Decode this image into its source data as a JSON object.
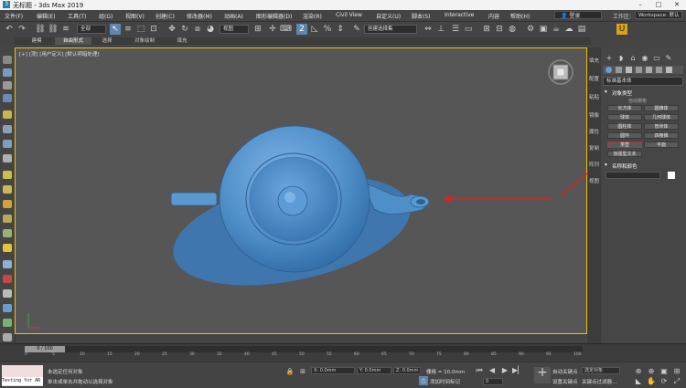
{
  "window": {
    "title": "无标题 - 3ds Max 2019",
    "app_icon": "3"
  },
  "menu": [
    "文件(F)",
    "编辑(E)",
    "工具(T)",
    "组(G)",
    "视图(V)",
    "创建(C)",
    "修改器(M)",
    "动画(A)",
    "图形编辑器(D)",
    "渲染(R)",
    "Civil View",
    "自定义(U)",
    "脚本(S)",
    "Interactive",
    "内容",
    "帮助(H)"
  ],
  "account": {
    "login": "登录",
    "workspace_label": "工作区:",
    "workspace": "Workspace: 默认"
  },
  "toolbar": {
    "selection_set": "全部",
    "view_combo": "视图",
    "named_selection": "创建选择集"
  },
  "ribbon_tabs": [
    "建模",
    "自由形式",
    "选择",
    "对象绘制",
    "填充"
  ],
  "viewport": {
    "label": "[+] [顶] [用户定义] [默认明暗处理]"
  },
  "right_tabs": [
    "填充",
    "配置",
    "粘贴",
    "镜像",
    "属性",
    "复制",
    "阵列",
    "视图"
  ],
  "command_panel": {
    "category": "标准基本体",
    "section_title": "对象类型",
    "autogrid": "自动栅格",
    "buttons": [
      "长方体",
      "圆锥体",
      "球体",
      "几何球体",
      "圆柱体",
      "管状体",
      "圆环",
      "四棱锥",
      "茶壶",
      "平面",
      "加强型文本",
      ""
    ],
    "name_color": "名称和颜色"
  },
  "timeline": {
    "frame": "0 / 100",
    "ticks": [
      "0",
      "5",
      "10",
      "15",
      "20",
      "25",
      "30",
      "35",
      "40",
      "45",
      "50",
      "55",
      "60",
      "65",
      "70",
      "75",
      "80",
      "85",
      "90",
      "95",
      "100"
    ]
  },
  "status": {
    "maxscript": "Testing for AR",
    "line1": "未选定任何对象",
    "line2": "单击或单击并拖动以选择对象",
    "x": "X: 0.0mm",
    "y": "Y: 0.0mm",
    "z": "Z: 0.0mm",
    "grid": "栅格 = 10.0mm",
    "add_time_tag": "添加时间标记",
    "auto_key": "自动关键点",
    "selected": "选定对象",
    "set_key": "设置关键点",
    "key_filters": "关键点过滤器...",
    "frame_value": "0"
  },
  "colors": {
    "teapot": "#4f8fc8",
    "highlight": "#e02020",
    "viewport_border": "#f0c000"
  }
}
